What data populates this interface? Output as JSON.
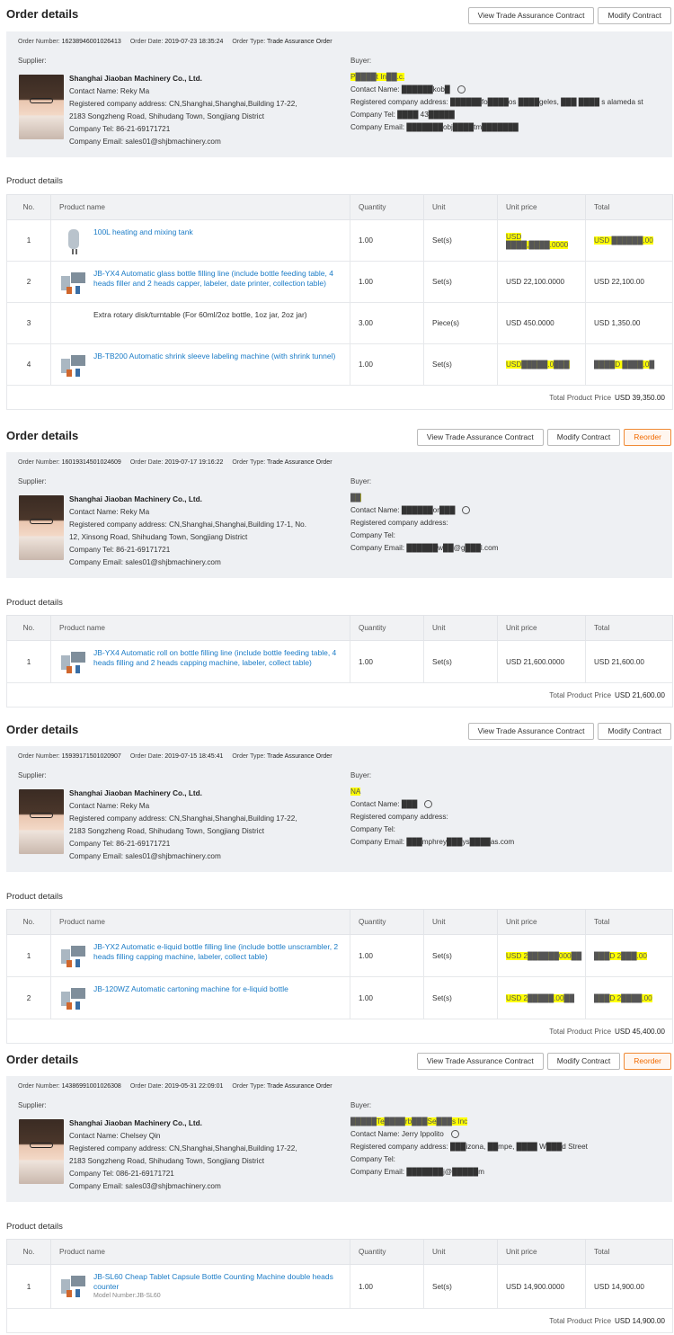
{
  "orders": [
    {
      "title": "Order details",
      "buttons": {
        "view": "View Trade Assurance Contract",
        "modify": "Modify Contract",
        "reorder": ""
      },
      "meta": {
        "number_label": "Order Number:",
        "number": "16238946001026413",
        "date_label": "Order Date:",
        "date": "2019-07-23 18:35:24",
        "type_label": "Order Type:",
        "type": "Trade Assurance Order"
      },
      "supplier_label": "Supplier:",
      "supplier": {
        "name": "Shanghai Jiaoban Machinery Co., Ltd.",
        "contact": "Contact Name: Reky Ma",
        "address1": "Registered company address: CN,Shanghai,Shanghai,Building 17-22,",
        "address2": "2183 Songzheng Road, Shihudang Town, Songjiang District",
        "tel": "Company Tel: 86-21-69171721",
        "email": "Company Email: sales01@shjbmachinery.com"
      },
      "buyer_label": "Buyer:",
      "buyer": {
        "name": "P████t In██.c.",
        "contact": "Contact Name: ██████kob█",
        "address": "Registered company address: ██████fo████os ████geles, ███ ████ s alameda st",
        "tel": "Company Tel: ████ 43█████",
        "email": "Company Email: ███████obj████tm███████"
      },
      "product_section": "Product details",
      "headers": [
        "No.",
        "Product name",
        "Quantity",
        "Unit",
        "Unit price",
        "Total"
      ],
      "rows": [
        {
          "no": "1",
          "name": "100L heating and mixing tank",
          "link": true,
          "thumb": "tank",
          "qty": "1.00",
          "unit": "Set(s)",
          "price": "USD ████,████.0000",
          "total": "USD ██████.00"
        },
        {
          "no": "2",
          "name": "JB-YX4 Automatic glass bottle filling line (include bottle feeding table, 4 heads filler and 2 heads capper, labeler, date printer, collection table)",
          "link": true,
          "thumb": "line",
          "qty": "1.00",
          "unit": "Set(s)",
          "price": "USD 22,100.0000",
          "total": "USD 22,100.00"
        },
        {
          "no": "3",
          "name": "Extra rotary disk/turntable (For 60ml/2oz bottle, 1oz jar, 2oz jar)",
          "link": false,
          "thumb": "",
          "qty": "3.00",
          "unit": "Piece(s)",
          "price": "USD 450.0000",
          "total": "USD 1,350.00"
        },
        {
          "no": "4",
          "name": "JB-TB200 Automatic shrink sleeve labeling machine (with shrink tunnel)",
          "link": true,
          "thumb": "line",
          "qty": "1.00",
          "unit": "Set(s)",
          "price": "USD█████.0███",
          "total": "████D ████.0█"
        }
      ],
      "total_label": "Total Product Price",
      "total": "USD 39,350.00"
    },
    {
      "title": "Order details",
      "buttons": {
        "view": "View Trade Assurance Contract",
        "modify": "Modify Contract",
        "reorder": "Reorder"
      },
      "meta": {
        "number_label": "Order Number:",
        "number": "16019314501024609",
        "date_label": "Order Date:",
        "date": "2019-07-17 19:16:22",
        "type_label": "Order Type:",
        "type": "Trade Assurance Order"
      },
      "supplier_label": "Supplier:",
      "supplier": {
        "name": "Shanghai Jiaoban Machinery Co., Ltd.",
        "contact": "Contact Name: Reky Ma",
        "address1": "Registered company address: CN,Shanghai,Shanghai,Building 17-1, No.",
        "address2": "12, Xinsong Road, Shihudang Town, Songjiang District",
        "tel": "Company Tel: 86-21-69171721",
        "email": "Company Email: sales01@shjbmachinery.com"
      },
      "buyer_label": "Buyer:",
      "buyer": {
        "name": "██",
        "contact": "Contact Name: ██████or███",
        "address": "Registered company address:",
        "tel": "Company Tel:",
        "email": "Company Email: ██████w██@g███l.com"
      },
      "product_section": "Product details",
      "headers": [
        "No.",
        "Product name",
        "Quantity",
        "Unit",
        "Unit price",
        "Total"
      ],
      "rows": [
        {
          "no": "1",
          "name": "JB-YX4 Automatic roll on bottle filling line (include bottle feeding table, 4 heads filling and 2 heads capping machine, labeler, collect table)",
          "link": true,
          "thumb": "line",
          "qty": "1.00",
          "unit": "Set(s)",
          "price": "USD 21,600.0000",
          "total": "USD 21,600.00"
        }
      ],
      "total_label": "Total Product Price",
      "total": "USD 21,600.00"
    },
    {
      "title": "Order details",
      "buttons": {
        "view": "View Trade Assurance Contract",
        "modify": "Modify Contract",
        "reorder": ""
      },
      "meta": {
        "number_label": "Order Number:",
        "number": "15939171501020907",
        "date_label": "Order Date:",
        "date": "2019-07-15 18:45:41",
        "type_label": "Order Type:",
        "type": "Trade Assurance Order"
      },
      "supplier_label": "Supplier:",
      "supplier": {
        "name": "Shanghai Jiaoban Machinery Co., Ltd.",
        "contact": "Contact Name: Reky Ma",
        "address1": "Registered company address: CN,Shanghai,Shanghai,Building 17-22,",
        "address2": "2183 Songzheng Road, Shihudang Town, Songjiang District",
        "tel": "Company Tel: 86-21-69171721",
        "email": "Company Email: sales01@shjbmachinery.com"
      },
      "buyer_label": "Buyer:",
      "buyer": {
        "name": "NA",
        "contact": "Contact Name: ███",
        "address": "Registered company address:",
        "tel": "Company Tel:",
        "email": "Company Email: ███mphrey███ys████as.com"
      },
      "product_section": "Product details",
      "headers": [
        "No.",
        "Product name",
        "Quantity",
        "Unit",
        "Unit price",
        "Total"
      ],
      "rows": [
        {
          "no": "1",
          "name": "JB-YX2 Automatic e-liquid bottle filling line (include bottle unscrambler, 2 heads filling capping machine, labeler, collect table)",
          "link": true,
          "thumb": "line",
          "qty": "1.00",
          "unit": "Set(s)",
          "price": "USD 2██████000██",
          "total": "███D 2███.00"
        },
        {
          "no": "2",
          "name": "JB-120WZ Automatic cartoning machine for e-liquid bottle",
          "link": true,
          "thumb": "line",
          "qty": "1.00",
          "unit": "Set(s)",
          "price": "USD 2█████.00██",
          "total": "███D 2████.00"
        }
      ],
      "total_label": "Total Product Price",
      "total": "USD 45,400.00"
    },
    {
      "title": "Order details",
      "buttons": {
        "view": "View Trade Assurance Contract",
        "modify": "Modify Contract",
        "reorder": "Reorder"
      },
      "meta": {
        "number_label": "Order Number:",
        "number": "14386991001026308",
        "date_label": "Order Date:",
        "date": "2019-05-31 22:09:01",
        "type_label": "Order Type:",
        "type": "Trade Assurance Order"
      },
      "supplier_label": "Supplier:",
      "supplier": {
        "name": "Shanghai Jiaoban Machinery Co., Ltd.",
        "contact": "Contact Name: Chelsey Qin",
        "address1": "Registered company address: CN,Shanghai,Shanghai,Building 17-22,",
        "address2": "2183 Songzheng Road, Shihudang Town, Songjiang District",
        "tel": "Company Tel: 086-21-69171721",
        "email": "Company Email: sales03@shjbmachinery.com"
      },
      "buyer_label": "Buyer:",
      "buyer": {
        "name": "█████Te████rb███Se███s Inc",
        "contact": "Contact Name: Jerry Ippolito",
        "address": "Registered company address: ███izona, ██mpe, ████ W███d Street",
        "tel": "Company Tel:",
        "email": "Company Email: ███████j@█████m"
      },
      "product_section": "Product details",
      "headers": [
        "No.",
        "Product name",
        "Quantity",
        "Unit",
        "Unit price",
        "Total"
      ],
      "rows": [
        {
          "no": "1",
          "name": "JB-SL60 Cheap Tablet Capsule Bottle Counting Machine double heads counter",
          "model": "Model Number:JB-SL60",
          "link": true,
          "thumb": "line",
          "qty": "1.00",
          "unit": "Set(s)",
          "price": "USD 14,900.0000",
          "total": "USD 14,900.00"
        }
      ],
      "total_label": "Total Product Price",
      "total": "USD 14,900.00"
    }
  ]
}
